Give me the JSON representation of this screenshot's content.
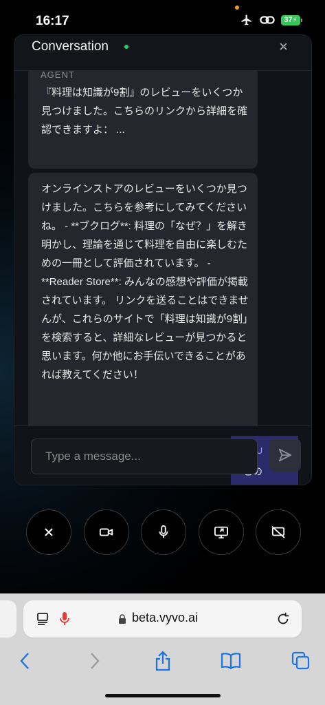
{
  "status_bar": {
    "time": "16:17",
    "battery": "37"
  },
  "conversation": {
    "title": "Conversation",
    "close_symbol": "×",
    "messages": [
      {
        "sender": "AGENT",
        "text": "『料理は知識が9割』のレビューをいくつか見つけました。こちらのリンクから詳細を確認できますよ： ..."
      },
      {
        "sender": "",
        "text": "オンラインストアのレビューをいくつか見つけました。こちらを参考にしてみてくださいね。 - **ブクログ**: 料理の「なぜ？」を解き明かし、理論を通じて料理を自由に楽しむための一冊として評価されています。 - **Reader Store**: みんなの感想や評価が掲載されています。 リンクを送ることはできませんが、これらのサイトで「料理は知識が9割」を検索すると、詳細なレビューが見つかると思います。何か他にお手伝いできることがあれば教えてください！"
      }
    ],
    "composer": {
      "placeholder": "Type a message...",
      "you_label": "YOU",
      "you_preview": "この"
    }
  },
  "browser": {
    "url": "beta.vyvo.ai"
  }
}
